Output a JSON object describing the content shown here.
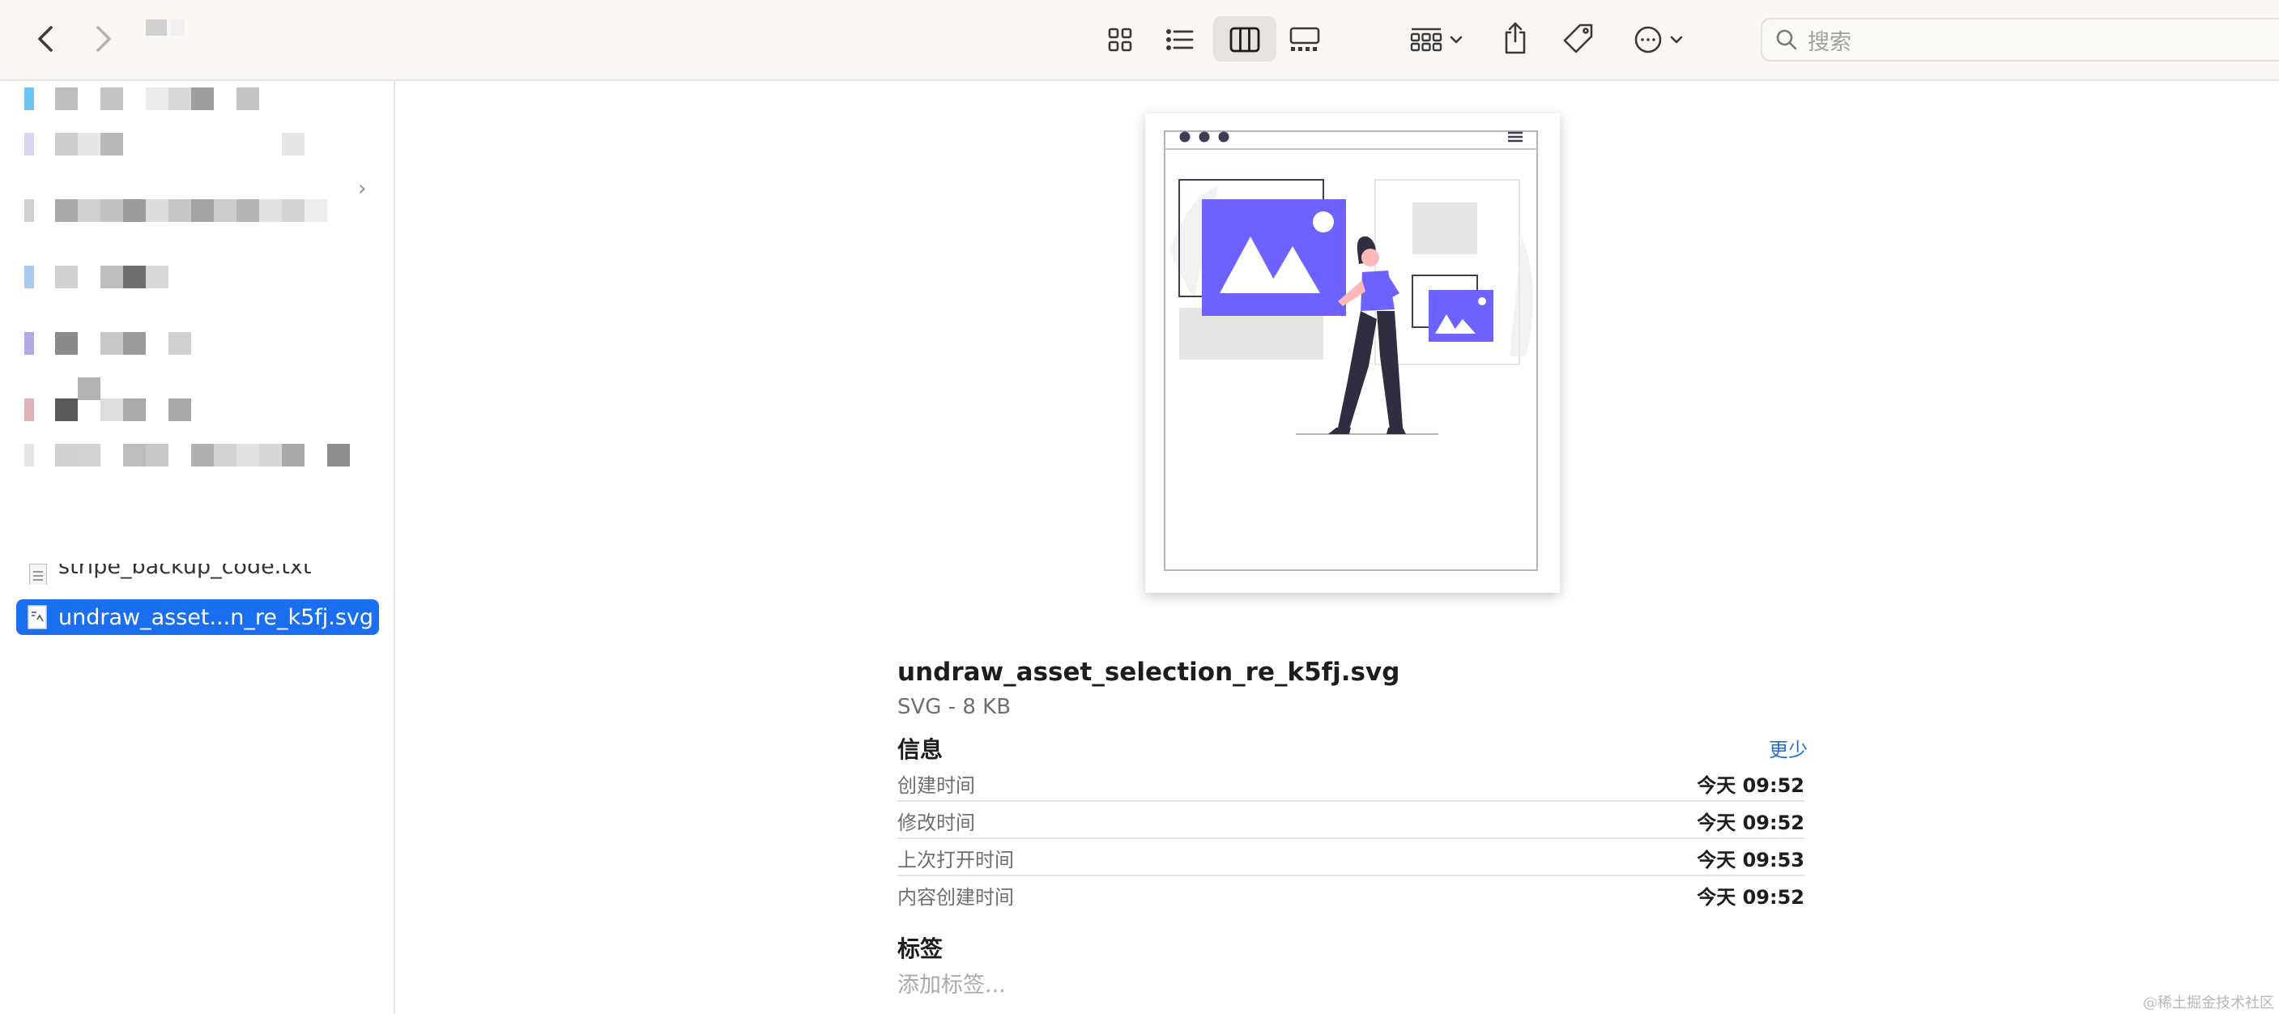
{
  "toolbar": {
    "back_icon": "chevron-left-icon",
    "forward_icon": "chevron-right-icon",
    "view_icons": [
      "grid-icon",
      "list-icon",
      "columns-icon",
      "gallery-icon"
    ],
    "active_view": "columns",
    "group_icon": "group-by-icon",
    "share_icon": "share-icon",
    "tag_icon": "tag-icon",
    "more_icon": "ellipsis-circle-icon",
    "search_placeholder": "搜索"
  },
  "sidebar": {
    "partial_file": "stripe_backup_code.txt",
    "selected_file": "undraw_asset...n_re_k5fj.svg"
  },
  "preview": {
    "file_name": "undraw_asset_selection_re_k5fj.svg",
    "kind": "SVG - 8 KB",
    "info_title": "信息",
    "show_less": "更少",
    "rows": [
      {
        "label": "创建时间",
        "value": "今天 09:52"
      },
      {
        "label": "修改时间",
        "value": "今天 09:52"
      },
      {
        "label": "上次打开时间",
        "value": "今天 09:53"
      },
      {
        "label": "内容创建时间",
        "value": "今天 09:52"
      }
    ],
    "tags_title": "标签",
    "tags_placeholder": "添加标签..."
  },
  "colors": {
    "accent": "#1a6ff0",
    "illustration_primary": "#6c63ff",
    "illustration_dark": "#2f2e41"
  },
  "watermark": "@稀土掘金技术社区"
}
